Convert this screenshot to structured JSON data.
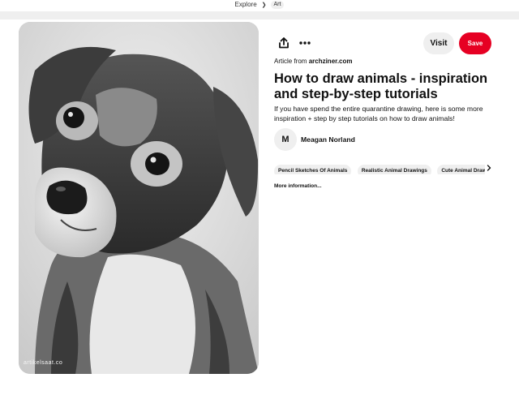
{
  "breadcrumb": {
    "items": [
      "Explore",
      "Art"
    ]
  },
  "pin": {
    "watermark": "artikelsaat.co",
    "share_icon": "share-icon",
    "more_icon": "ellipsis-icon"
  },
  "actions": {
    "visit_label": "Visit",
    "save_label": "Save"
  },
  "source": {
    "prefix": "Article from",
    "domain": "archziner.com"
  },
  "title": "How to draw animals - inspiration and step-by-step tutorials",
  "description": "If you have spend the entire quarantine drawing, here is some more inspiration + step by step tutorials on how to draw animals!",
  "author": {
    "initial": "M",
    "name": "Meagan Norland"
  },
  "tags": [
    "Pencil Sketches Of Animals",
    "Realistic Animal Drawings",
    "Cute Animal Drawings"
  ],
  "more_info_label": "More information...",
  "colors": {
    "save_bg": "#e60023",
    "pill_bg": "#efefef",
    "text": "#111111"
  }
}
